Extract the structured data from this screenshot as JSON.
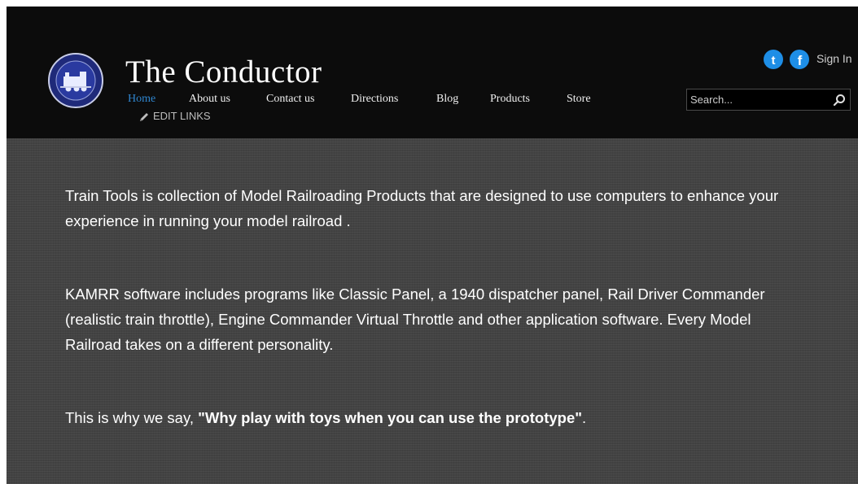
{
  "header": {
    "site_title": "The Conductor",
    "logo_icon": "kamrr-logo-icon",
    "nav": [
      {
        "label": "Home",
        "active": true
      },
      {
        "label": "About us",
        "active": false
      },
      {
        "label": "Contact us",
        "active": false
      },
      {
        "label": "Directions",
        "active": false
      },
      {
        "label": "Blog",
        "active": false
      },
      {
        "label": "Products",
        "active": false
      },
      {
        "label": "Store",
        "active": false
      }
    ],
    "edit_links": "EDIT LINKS",
    "social": [
      {
        "icon": "twitter-icon",
        "color": "#1e8ee6"
      },
      {
        "icon": "facebook-icon",
        "color": "#1e8ee6"
      }
    ],
    "sign_in": "Sign In",
    "search": {
      "placeholder": "Search...",
      "value": "",
      "icon": "search-icon"
    }
  },
  "content": {
    "p1": "Train Tools is collection of Model Railroading Products that are designed to use computers to enhance your experience in running your model railroad .",
    "p2": "KAMRR software includes programs like Classic Panel, a 1940 dispatcher panel, Rail Driver Commander (realistic train throttle), Engine Commander Virtual Throttle and other application software. Every Model Railroad takes on a different personality.",
    "p3_prefix": "This is why we say, ",
    "p3_quote": "\"Why play with toys when you can use the prototype\"",
    "p3_suffix": "."
  },
  "colors": {
    "header_bg": "#0c0c0c",
    "content_bg": "#434343",
    "active_nav": "#2f86cf",
    "text": "#ffffff",
    "social_blue": "#1e8ee6"
  }
}
